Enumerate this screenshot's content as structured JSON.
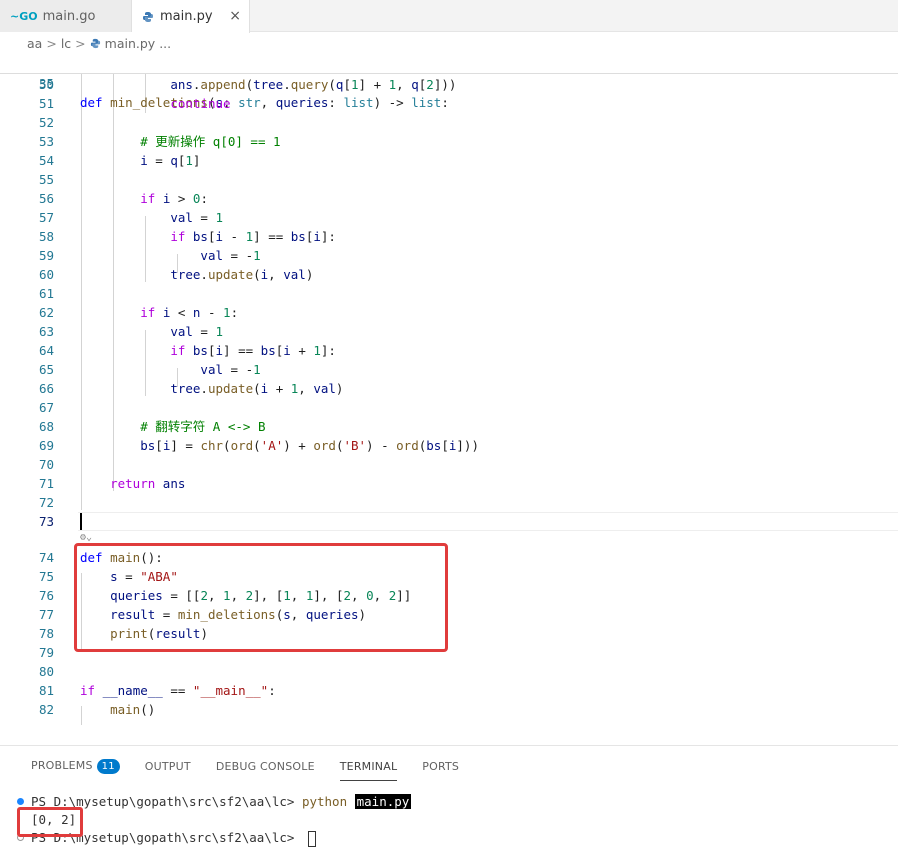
{
  "tabs": [
    {
      "label": "main.go",
      "icon": "go-file-icon",
      "active": false
    },
    {
      "label": "main.py",
      "icon": "python-file-icon",
      "active": true,
      "close": "×"
    }
  ],
  "breadcrumb": {
    "parts": [
      "aa",
      "lc",
      "main.py",
      "..."
    ],
    "separator": ">"
  },
  "editor": {
    "sticky_line_number": "35",
    "line_numbers": [
      "50",
      "51",
      "52",
      "53",
      "54",
      "55",
      "56",
      "57",
      "58",
      "59",
      "60",
      "61",
      "62",
      "63",
      "64",
      "65",
      "66",
      "67",
      "68",
      "69",
      "70",
      "71",
      "72",
      "73",
      "74",
      "75",
      "76",
      "77",
      "78",
      "79",
      "80",
      "81",
      "82"
    ],
    "sticky_def": "def",
    "sticky_fn": "min_deletions",
    "sticky_params": "(s: str, queries: list) -> list:"
  },
  "panel": {
    "tabs": [
      "PROBLEMS",
      "OUTPUT",
      "DEBUG CONSOLE",
      "TERMINAL",
      "PORTS"
    ],
    "active_tab": "TERMINAL",
    "problems_count": "11",
    "terminal": {
      "prompt1": "PS D:\\mysetup\\gopath\\src\\sf2\\aa\\lc> ",
      "command": "python",
      "arg": "main.py",
      "output": "[0, 2]",
      "prompt2": "PS D:\\mysetup\\gopath\\src\\sf2\\aa\\lc> "
    }
  },
  "colors": {
    "highlight_box": "#e03c3c",
    "line_number": "#237893",
    "keyword": "#0000ff"
  }
}
